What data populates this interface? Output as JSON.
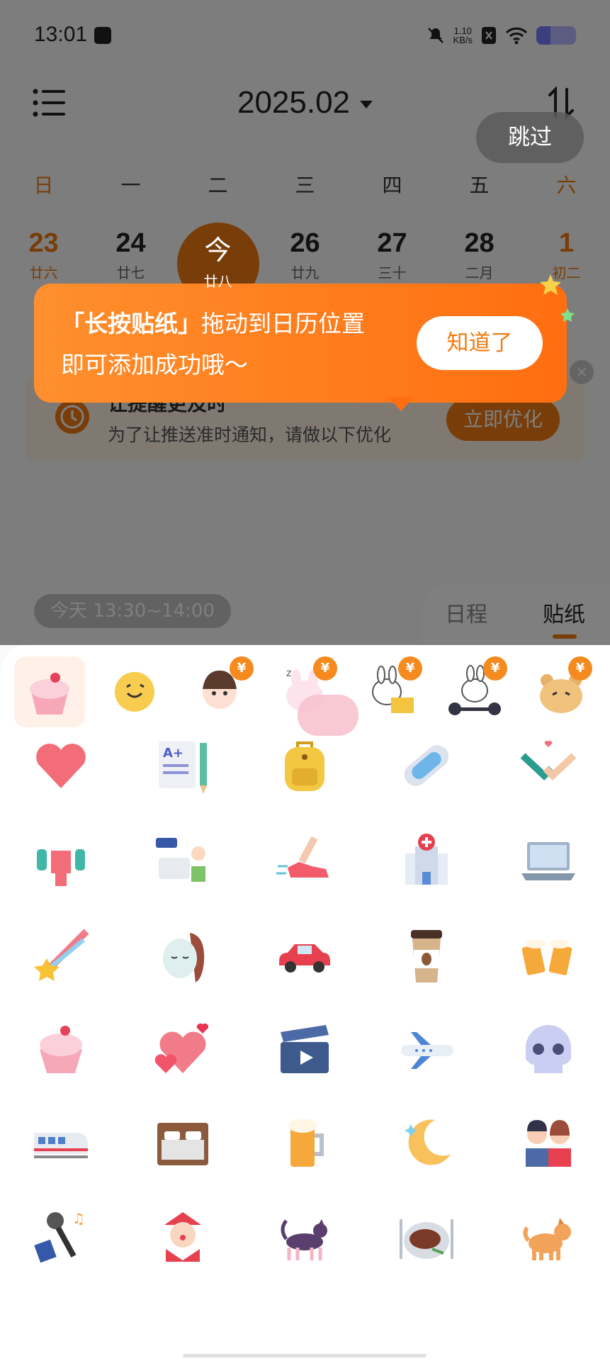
{
  "status_bar": {
    "time": "13:01",
    "net_speed_value": "1.10",
    "net_speed_unit": "KB/s",
    "battery_level": 0.35
  },
  "header": {
    "month": "2025.02"
  },
  "weekdays": [
    "日",
    "一",
    "二",
    "三",
    "四",
    "五",
    "六"
  ],
  "dates": [
    {
      "num": "23",
      "lunar": "廿六"
    },
    {
      "num": "24",
      "lunar": "廿七"
    },
    {
      "num": "今",
      "lunar": "廿八"
    },
    {
      "num": "26",
      "lunar": "廿九"
    },
    {
      "num": "27",
      "lunar": "三十"
    },
    {
      "num": "28",
      "lunar": "二月"
    },
    {
      "num": "1",
      "lunar": "初二"
    }
  ],
  "optimize_card": {
    "title": "让提醒更及时",
    "description": "为了让推送准时通知，请做以下优化",
    "button": "立即优化"
  },
  "schedule_pill": "今天 13:30~14:00",
  "tabs": {
    "schedule": "日程",
    "sticker": "贴纸"
  },
  "tooltip": {
    "line1_bold": "「长按贴纸」",
    "line1_rest": "拖动到日历位置",
    "line2": "即可添加成功哦～",
    "button": "知道了"
  },
  "skip": "跳过",
  "paid_badge": "¥",
  "colors": {
    "accent": "#f07b12",
    "tooltip": "#ff7a1a"
  },
  "stickers": [
    [
      "cupcake-icon",
      "smiley-icon",
      "girl-icon",
      "sleepy-bunny-icon",
      "bunny-laptop-icon",
      "bunny-gym-icon",
      "bear-icon"
    ],
    [
      "heart-icon",
      "document-grade-icon",
      "backpack-icon",
      "pad-icon",
      "handshake-icon"
    ],
    [
      "fitness-icon",
      "work-icon",
      "running-shoe-icon",
      "hospital-icon",
      "laptop-icon"
    ],
    [
      "shooting-star-icon",
      "face-mask-icon",
      "car-icon",
      "coffee-icon",
      "beer-cheers-icon"
    ],
    [
      "cupcake-icon",
      "hearts-icon",
      "clapperboard-icon",
      "airplane-icon",
      "skull-icon"
    ],
    [
      "train-icon",
      "bed-icon",
      "beer-icon",
      "moon-icon",
      "couple-icon"
    ],
    [
      "karaoke-icon",
      "clown-icon",
      "cat-icon",
      "steak-icon",
      "dog-icon"
    ]
  ]
}
